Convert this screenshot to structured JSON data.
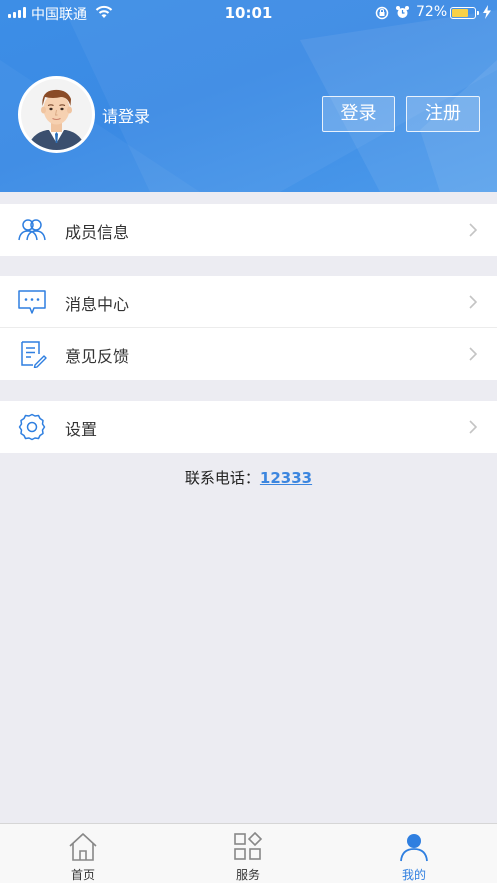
{
  "status_bar": {
    "carrier": "中国联通",
    "time": "10:01",
    "battery_percent": "72%",
    "battery_level": 0.72
  },
  "header": {
    "login_hint": "请登录",
    "login_button": "登录",
    "register_button": "注册"
  },
  "menu": {
    "member_info": "成员信息",
    "message_center": "消息中心",
    "feedback": "意见反馈",
    "settings": "设置"
  },
  "contact": {
    "label": "联系电话：",
    "phone": "12333"
  },
  "tabbar": {
    "home": "首页",
    "services": "服务",
    "mine": "我的",
    "active": "mine"
  },
  "colors": {
    "header_blue": "#3a8ae4",
    "accent": "#2f7fe0",
    "battery": "#f8d147"
  }
}
